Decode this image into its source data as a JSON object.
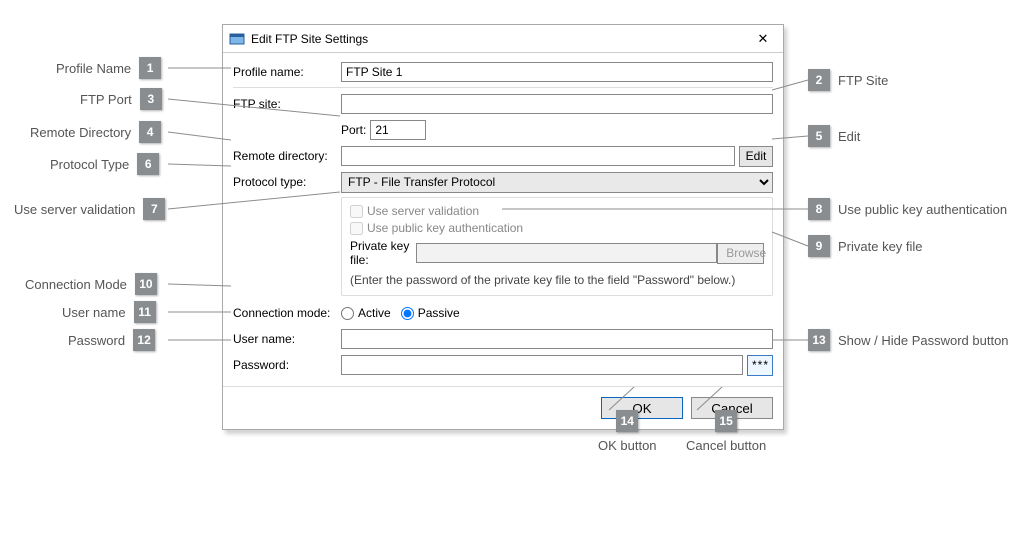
{
  "dialog": {
    "title": "Edit FTP Site Settings",
    "close_glyph": "✕",
    "fields": {
      "profile_name_label": "Profile name:",
      "profile_name_value": "FTP Site 1",
      "ftp_site_label": "FTP site:",
      "ftp_site_value": "",
      "port_label": "Port:",
      "port_value": "21",
      "remote_dir_label": "Remote directory:",
      "remote_dir_value": "",
      "edit_btn": "Edit",
      "protocol_label": "Protocol type:",
      "protocol_value": "FTP - File Transfer Protocol",
      "use_server_validation": "Use server validation",
      "use_public_key_auth": "Use public key authentication",
      "private_key_label": "Private key file:",
      "private_key_value": "",
      "browse_btn": "Browse",
      "private_key_hint": "(Enter the password of the private key file to the field \"Password\" below.)",
      "conn_mode_label": "Connection mode:",
      "conn_active": "Active",
      "conn_passive": "Passive",
      "user_label": "User name:",
      "user_value": "",
      "password_label": "Password:",
      "password_value": "",
      "stars_btn": "***",
      "ok_btn": "OK",
      "cancel_btn": "Cancel"
    }
  },
  "callouts": {
    "1": "Profile Name",
    "2": "FTP Site",
    "3": "FTP Port",
    "4": "Remote Directory",
    "5": "Edit",
    "6": "Protocol Type",
    "7": "Use server validation",
    "8": "Use public key authentication",
    "9": "Private key file",
    "10": "Connection Mode",
    "11": "User name",
    "12": "Password",
    "13": "Show / Hide Password button",
    "14": "OK button",
    "15": "Cancel button"
  }
}
